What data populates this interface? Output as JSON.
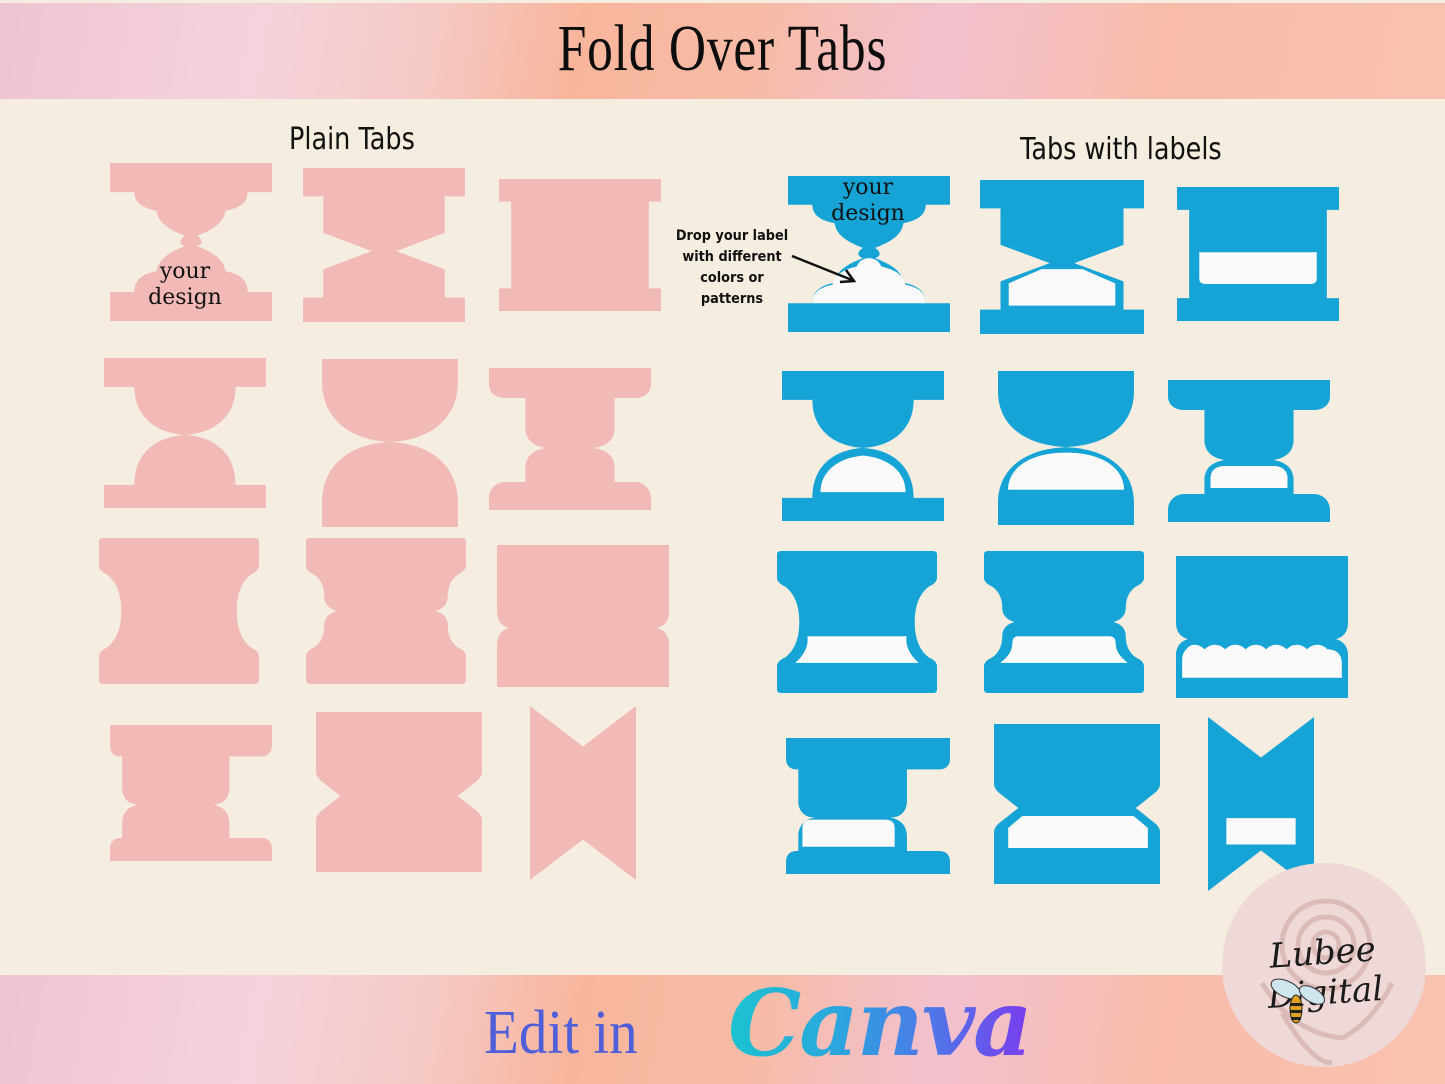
{
  "header": {
    "title": "Fold Over Tabs"
  },
  "colors": {
    "background": "#f4ede0",
    "plain_tab": "#f2bab7",
    "labeled_tab": "#16a4d6",
    "label_fill": "#fafafa",
    "edit_text": "#4f5fd9"
  },
  "plain_section": {
    "title": "Plain Tabs",
    "sample_text_line1": "your",
    "sample_text_line2": "design",
    "tabs": [
      {
        "name": "scallop-hourglass"
      },
      {
        "name": "angled-hourglass"
      },
      {
        "name": "straight-notch"
      },
      {
        "name": "round-shoulder-hourglass"
      },
      {
        "name": "semicircle-hourglass"
      },
      {
        "name": "rounded-step"
      },
      {
        "name": "concave-sides"
      },
      {
        "name": "wavy-sides"
      },
      {
        "name": "scalloped-seam"
      },
      {
        "name": "offset-step"
      },
      {
        "name": "v-notch-sides"
      },
      {
        "name": "ribbon"
      }
    ]
  },
  "labels_section": {
    "title": "Tabs with labels",
    "sample_text_line1": "your",
    "sample_text_line2": "design",
    "annotation": [
      "Drop your label",
      "with different",
      "colors or patterns"
    ],
    "tabs": [
      {
        "name": "scallop-hourglass-label"
      },
      {
        "name": "angled-hourglass-label"
      },
      {
        "name": "straight-notch-label"
      },
      {
        "name": "round-shoulder-hourglass-label"
      },
      {
        "name": "semicircle-hourglass-label"
      },
      {
        "name": "rounded-step-label"
      },
      {
        "name": "concave-sides-label"
      },
      {
        "name": "wavy-sides-label"
      },
      {
        "name": "scalloped-seam-label"
      },
      {
        "name": "offset-step-label"
      },
      {
        "name": "v-notch-sides-label"
      },
      {
        "name": "ribbon-label"
      }
    ]
  },
  "footer": {
    "edit_label": "Edit in",
    "brand": "Canva",
    "logo_text": "Lubee Digital"
  }
}
